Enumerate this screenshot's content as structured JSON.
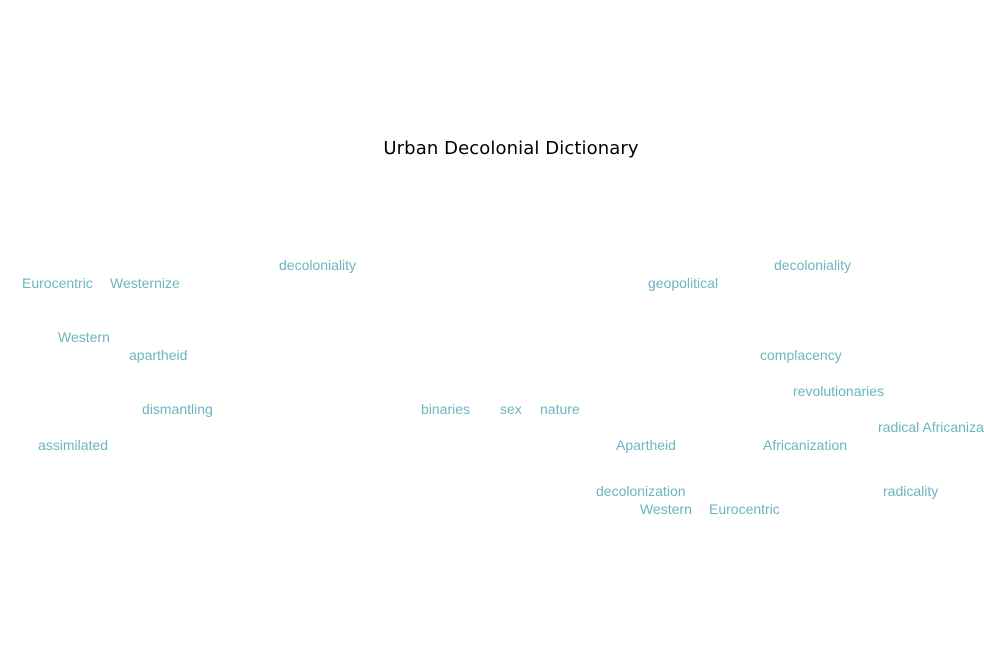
{
  "title": "Urban Decolonial Dictionary",
  "word_color": "#6bb6bf",
  "words": [
    "decoloniality",
    "Eurocentric",
    "Westernize",
    "Western",
    "apartheid",
    "dismantling",
    "assimilated",
    "binaries",
    "sex",
    "nature",
    "decoloniality",
    "geopolitical",
    "complacency",
    "revolutionaries",
    "radical Africanizati",
    "Apartheid",
    "Africanization",
    "decolonization",
    "radicality",
    "Western",
    "Eurocentric"
  ]
}
